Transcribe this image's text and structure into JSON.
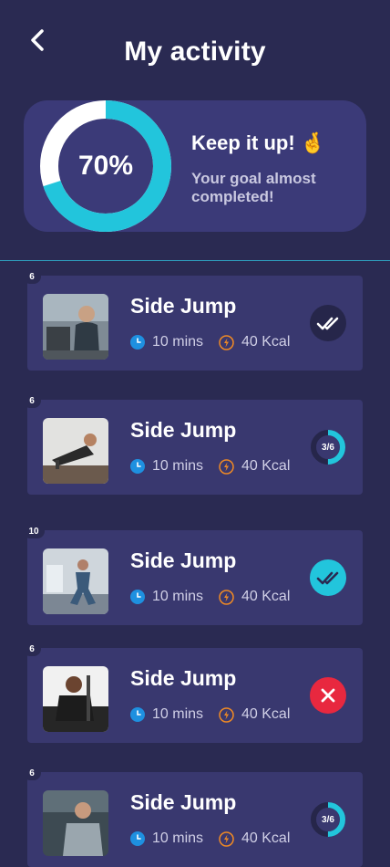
{
  "header": {
    "title": "My activity",
    "back_icon": "chevron-left-icon"
  },
  "goal": {
    "percent_label": "70%",
    "progress": 0.7,
    "headline": "Keep it up!",
    "headline_emoji": "🤞",
    "subtext": "Your goal almost completed!",
    "ring_color": "#22c5dc",
    "track_color": "#ffffff"
  },
  "activities": [
    {
      "name": "Side Jump",
      "count": "6",
      "time": "10 mins",
      "kcal": "40 Kcal",
      "status": "done",
      "status_icon": "double-check-icon"
    },
    {
      "name": "Side Jump",
      "count": "6",
      "time": "10 mins",
      "kcal": "40 Kcal",
      "status": "in-progress",
      "progress_label": "3/6",
      "progress": 0.5
    },
    {
      "name": "Side Jump",
      "count": "10",
      "time": "10 mins",
      "kcal": "40 Kcal",
      "status": "completed",
      "status_icon": "double-check-icon"
    },
    {
      "name": "Side Jump",
      "count": "6",
      "time": "10 mins",
      "kcal": "40 Kcal",
      "status": "failed",
      "status_icon": "close-icon"
    },
    {
      "name": "Side Jump",
      "count": "6",
      "time": "10 mins",
      "kcal": "40 Kcal",
      "status": "in-progress",
      "progress_label": "3/6",
      "progress": 0.5
    }
  ],
  "colors": {
    "background": "#2a2a52",
    "card": "#39386f",
    "accent": "#22c5dc",
    "clock": "#1e90e0",
    "flame": "#f08a24",
    "failed": "#e8283f"
  }
}
